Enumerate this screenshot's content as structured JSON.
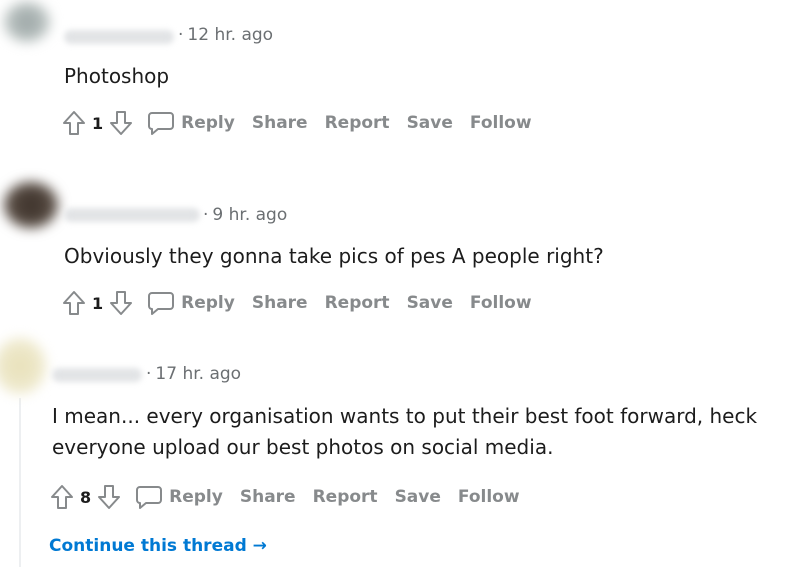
{
  "comments": [
    {
      "time": "12 hr. ago",
      "text": "Photoshop",
      "votes": "1",
      "actions": {
        "reply": "Reply",
        "share": "Share",
        "report": "Report",
        "save": "Save",
        "follow": "Follow"
      }
    },
    {
      "time": "9 hr. ago",
      "text": "Obviously they gonna take pics of pes A people right?",
      "votes": "1",
      "actions": {
        "reply": "Reply",
        "share": "Share",
        "report": "Report",
        "save": "Save",
        "follow": "Follow"
      }
    },
    {
      "time": "17 hr. ago",
      "text_line1": "I mean... every organisation wants to put their best foot forward, heck",
      "text_line2": "everyone upload our best photos on social media.",
      "votes": "8",
      "actions": {
        "reply": "Reply",
        "share": "Share",
        "report": "Report",
        "save": "Save",
        "follow": "Follow"
      }
    }
  ],
  "continue_thread": "Continue this thread →",
  "colors": {
    "text": "#1c1c1c",
    "meta": "#6b6f72",
    "action": "#878a8c",
    "link": "#0079d3"
  },
  "icons": [
    "upvote-icon",
    "downvote-icon",
    "comment-bubble-icon",
    "arrow-right-icon"
  ]
}
